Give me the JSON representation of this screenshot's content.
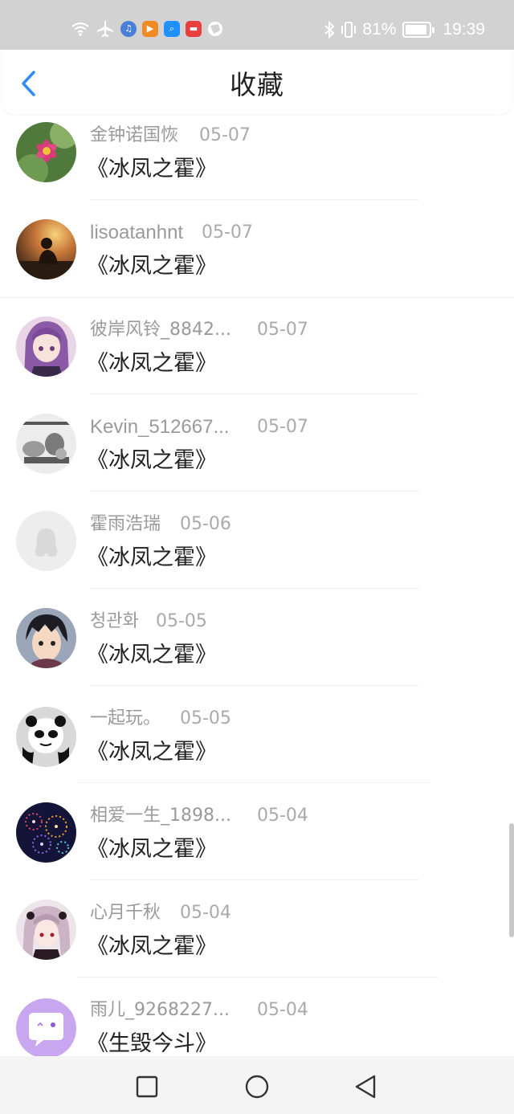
{
  "status_bar": {
    "battery": "81%",
    "time": "19:39",
    "icons": [
      "wifi-icon",
      "airplane-icon",
      "music-app-icon",
      "video-app-icon",
      "search-app-icon",
      "store-app-icon",
      "browser-app-icon",
      "bluetooth-icon",
      "vibrate-icon",
      "battery-icon"
    ]
  },
  "header": {
    "title": "收藏",
    "back_icon": "chevron-left-icon"
  },
  "items": [
    {
      "user": "金钟诺国恢",
      "date": "05-07",
      "book": "《冰凤之霍》",
      "avatar": "flower-photo"
    },
    {
      "user": "lisoatanhnt",
      "date": "05-07",
      "book": "《冰凤之霍》",
      "avatar": "sunset-silhouette"
    },
    {
      "user": "彼岸风铃_8842...",
      "date": "05-07",
      "book": "《冰凤之霍》",
      "avatar": "anime-girl-purple"
    },
    {
      "user": "Kevin_512667...",
      "date": "05-07",
      "book": "《冰凤之霍》",
      "avatar": "sketch-drawing"
    },
    {
      "user": "霍雨浩瑞",
      "date": "05-06",
      "book": "《冰凤之霍》",
      "avatar": "default-penguin"
    },
    {
      "user": "청관화",
      "date": "05-05",
      "book": "《冰凤之霍》",
      "avatar": "anime-boy"
    },
    {
      "user": "一起玩。",
      "date": "05-05",
      "book": "《冰凤之霍》",
      "avatar": "panda-meme"
    },
    {
      "user": "相爱一生_1898...",
      "date": "05-04",
      "book": "《冰凤之霍》",
      "avatar": "fireworks"
    },
    {
      "user": "心月千秋",
      "date": "05-04",
      "book": "《冰凤之霍》",
      "avatar": "anime-girl-dark"
    },
    {
      "user": "雨儿_9268227...",
      "date": "05-04",
      "book": "《生毁今斗》",
      "avatar": "chat-bubble-purple"
    }
  ],
  "nav_bar": {
    "buttons": [
      "recent-apps-icon",
      "home-icon",
      "back-triangle-icon"
    ]
  },
  "colors": {
    "accent": "#2f8cf0",
    "status_bar_bg": "#d2d2d2",
    "name_text": "#9a9a9a",
    "title_text": "#222222"
  }
}
